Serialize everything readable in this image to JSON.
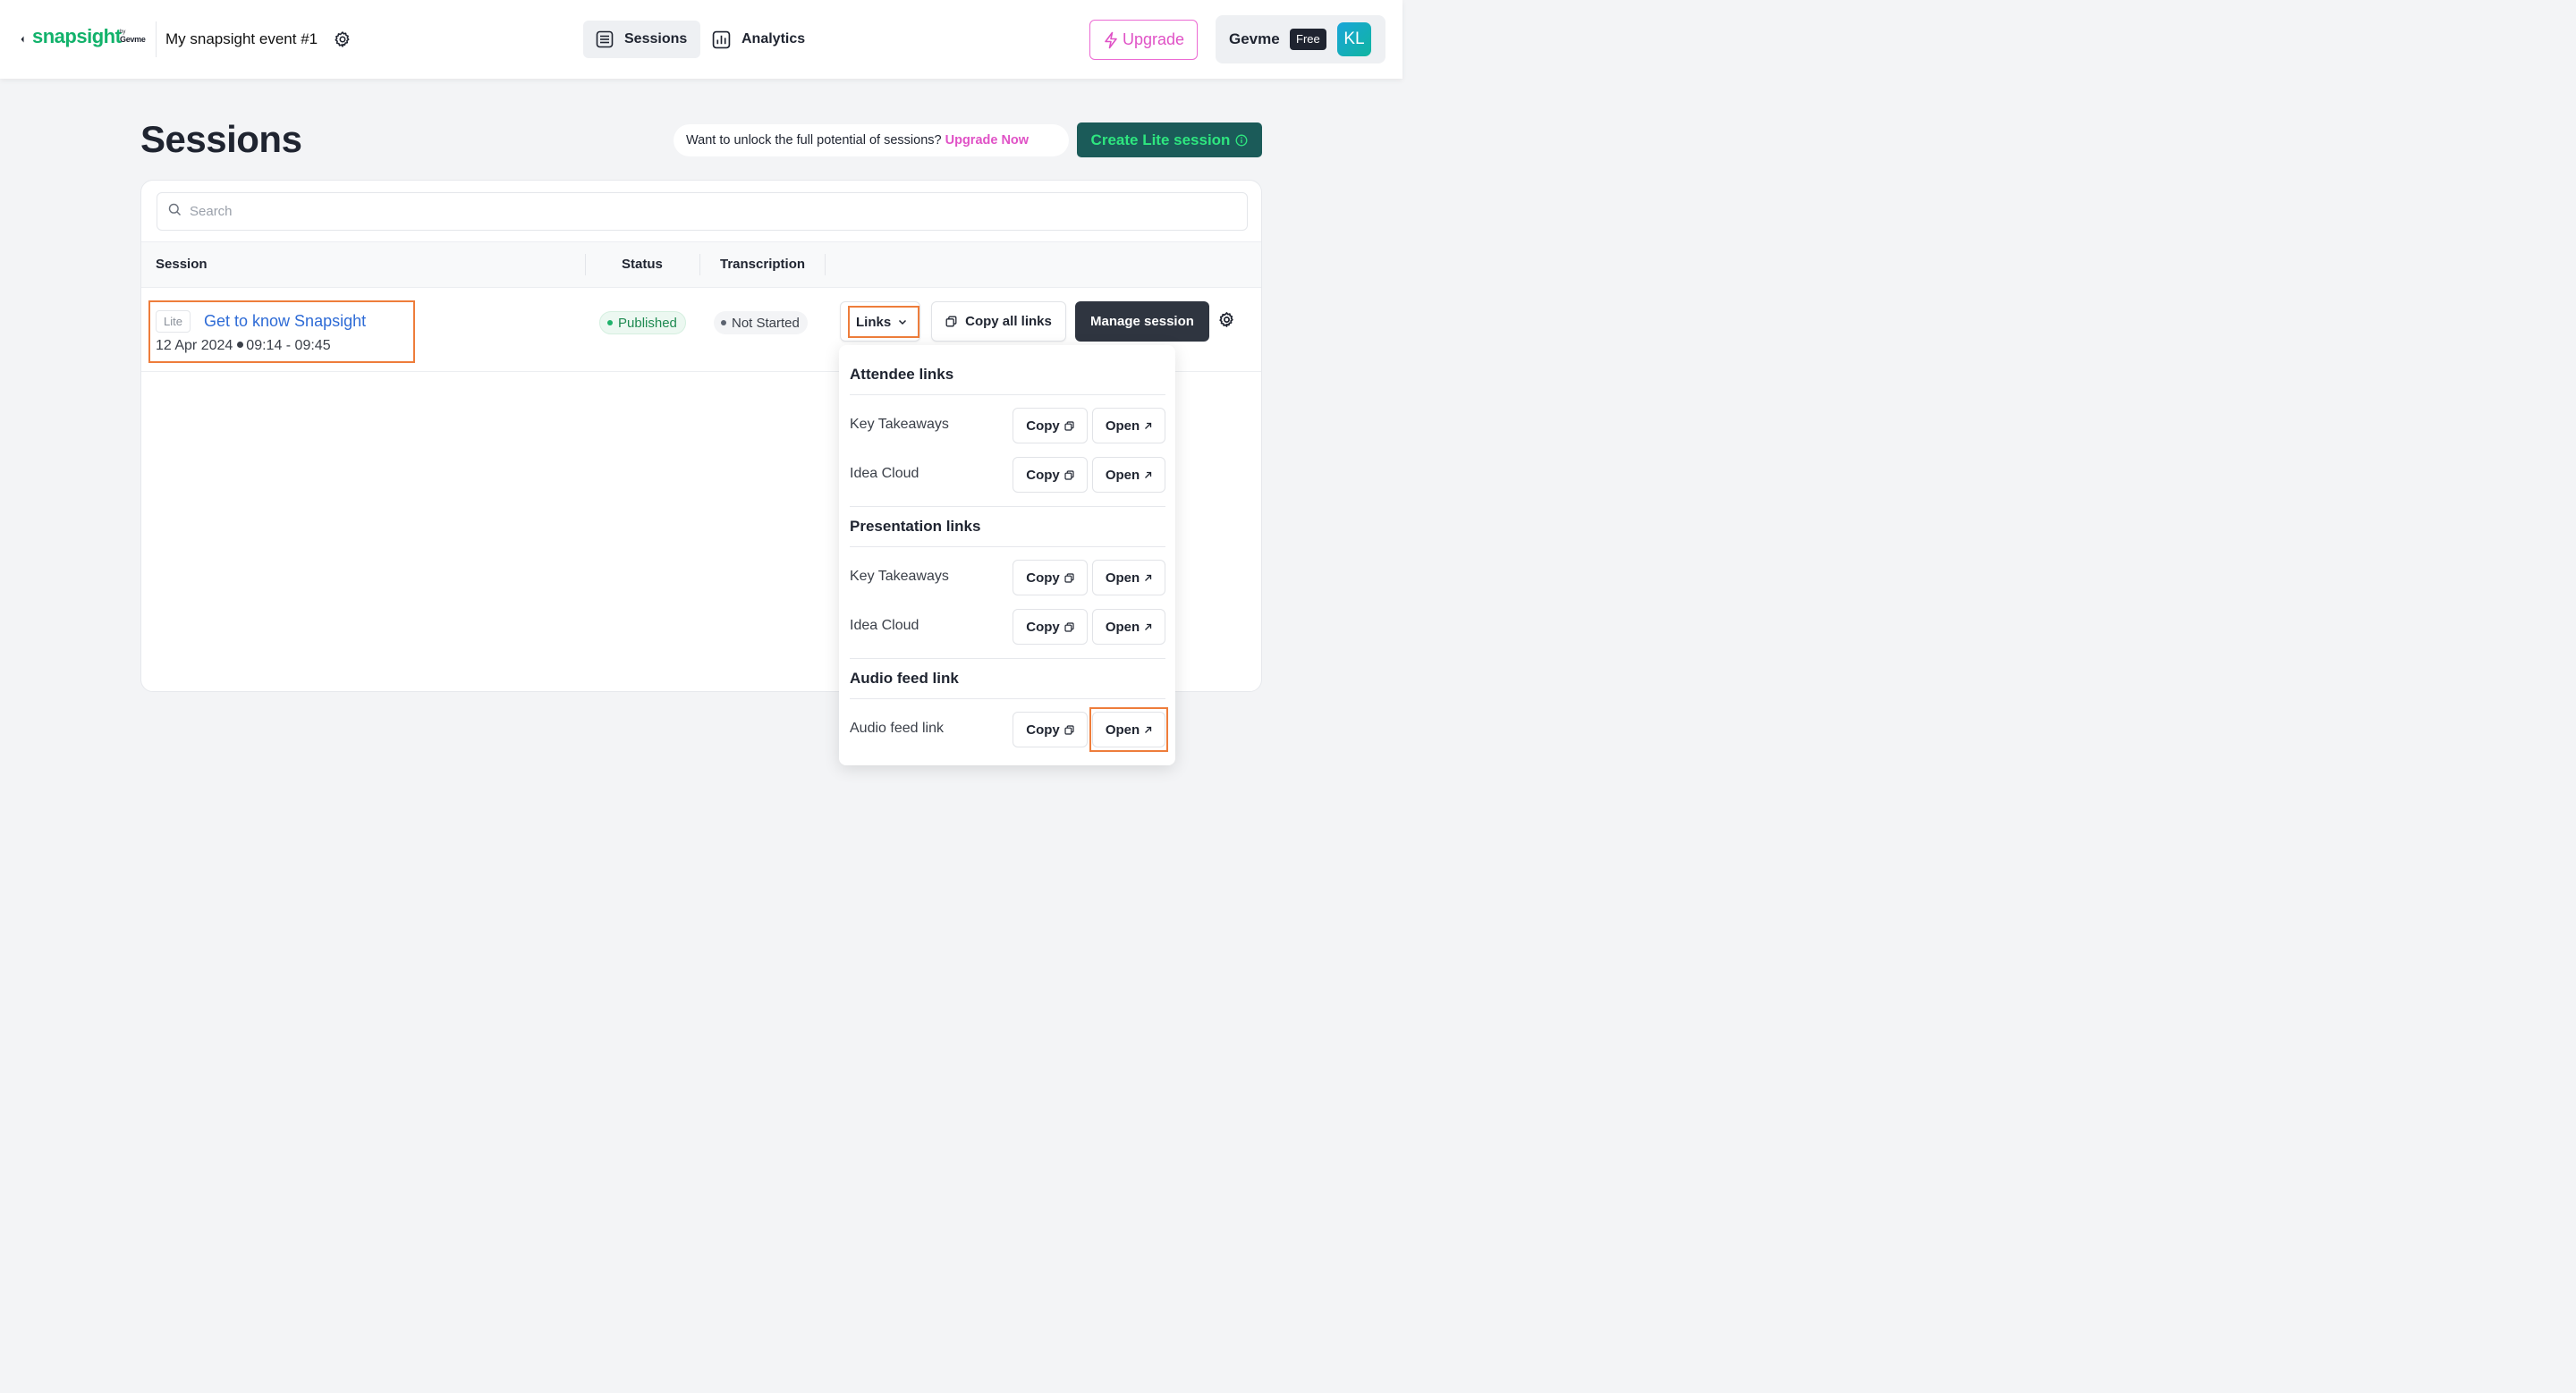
{
  "header": {
    "logo": "snapsight",
    "logo_by": "by",
    "logo_brand": "Gevme",
    "event_name": "My snapsight event #1",
    "nav": [
      {
        "label": "Sessions",
        "active": true
      },
      {
        "label": "Analytics",
        "active": false
      }
    ],
    "upgrade_label": "Upgrade",
    "account_name": "Gevme",
    "plan": "Free",
    "avatar_initials": "KL"
  },
  "page": {
    "title": "Sessions",
    "promo_text": "Want to unlock the full potential of sessions?",
    "promo_link": "Upgrade Now",
    "create_label": "Create Lite session"
  },
  "search": {
    "placeholder": "Search",
    "value": ""
  },
  "table": {
    "columns": [
      "Session",
      "Status",
      "Transcription"
    ],
    "rows": [
      {
        "badge": "Lite",
        "title": "Get to know Snapsight",
        "date": "12 Apr 2024",
        "time": "09:14 - 09:45",
        "status": "Published",
        "transcription": "Not Started",
        "links_label": "Links",
        "copy_all_label": "Copy all links",
        "manage_label": "Manage session"
      }
    ]
  },
  "links_menu": {
    "sections": [
      {
        "heading": "Attendee links",
        "items": [
          {
            "label": "Key Takeaways",
            "copy": "Copy",
            "open": "Open"
          },
          {
            "label": "Idea Cloud",
            "copy": "Copy",
            "open": "Open"
          }
        ]
      },
      {
        "heading": "Presentation links",
        "items": [
          {
            "label": "Key Takeaways",
            "copy": "Copy",
            "open": "Open"
          },
          {
            "label": "Idea Cloud",
            "copy": "Copy",
            "open": "Open"
          }
        ]
      },
      {
        "heading": "Audio feed link",
        "items": [
          {
            "label": "Audio feed link",
            "copy": "Copy",
            "open": "Open"
          }
        ]
      }
    ]
  },
  "colors": {
    "brand_green": "#12b26b",
    "upgrade_pink": "#e052c6",
    "create_bg": "#1b5b59",
    "create_text": "#2ee67f",
    "highlight_orange": "#ee7d3b",
    "manage_bg": "#2f3540",
    "link_blue": "#2e6bd6",
    "published_green": "#1e8a51"
  },
  "icons": {
    "back": "chevron-left-icon",
    "event_settings": "gear-icon",
    "sessions_nav": "list-icon",
    "analytics_nav": "bar-chart-icon",
    "upgrade": "lightning-icon",
    "create_info": "info-icon",
    "search": "search-icon",
    "links_chevron": "chevron-down-icon",
    "copy": "copy-icon",
    "open": "external-arrow-icon",
    "session_settings": "gear-icon"
  }
}
